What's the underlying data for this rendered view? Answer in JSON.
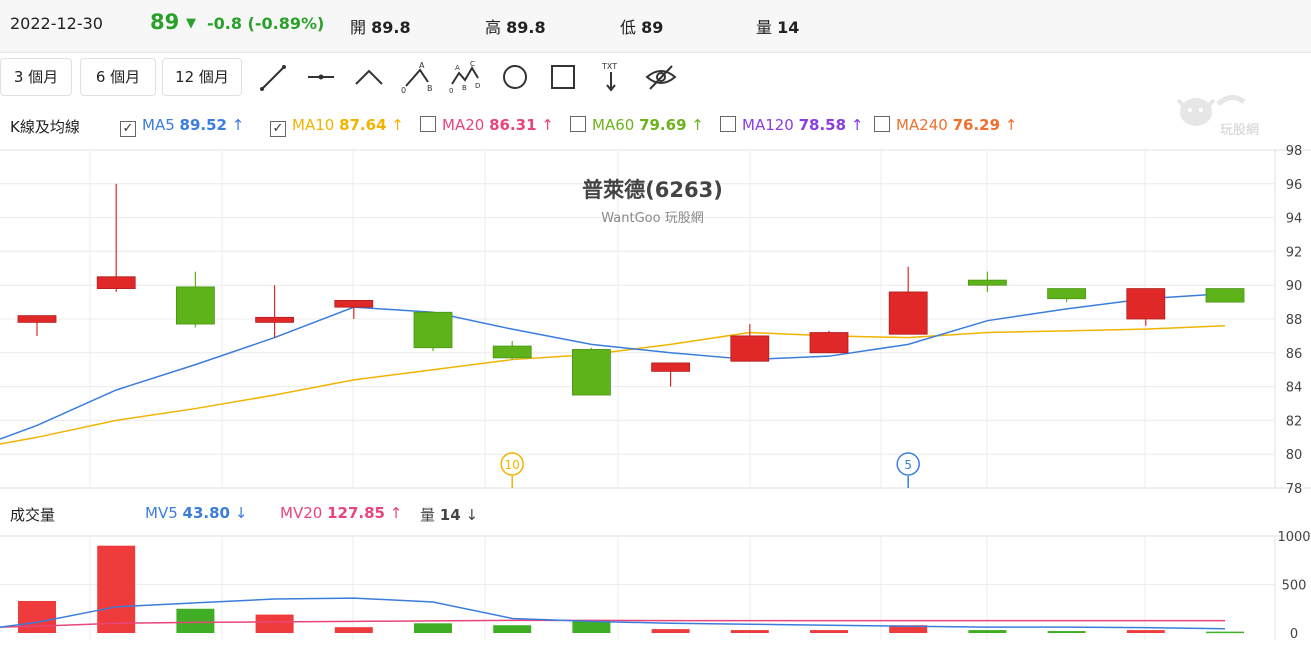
{
  "quote": {
    "date": "2022-12-30",
    "price": "89",
    "change": "-0.8 (-0.89%)",
    "open_label": "開",
    "open": "89.8",
    "high_label": "高",
    "high": "89.8",
    "low_label": "低",
    "low": "89",
    "volume_label": "量",
    "volume": "14"
  },
  "ranges": [
    "3 個月",
    "6 個月",
    "12 個月"
  ],
  "tools": [
    "line-tool-icon",
    "horizontal-line-tool-icon",
    "angle-tool-icon",
    "abc-pattern-tool-icon",
    "abcd-pattern-tool-icon",
    "circle-tool-icon",
    "rectangle-tool-icon",
    "text-tool-icon",
    "hide-drawings-icon"
  ],
  "kline_legend": {
    "label": "K線及均線",
    "items": [
      {
        "name": "MA5",
        "value": "89.52",
        "arrow": "↑",
        "checked": true,
        "color": "#3b7ddd"
      },
      {
        "name": "MA10",
        "value": "87.64",
        "arrow": "↑",
        "checked": true,
        "color": "#f0b400"
      },
      {
        "name": "MA20",
        "value": "86.31",
        "arrow": "↑",
        "checked": false,
        "color": "#e8457a"
      },
      {
        "name": "MA60",
        "value": "79.69",
        "arrow": "↑",
        "checked": false,
        "color": "#6bb31a"
      },
      {
        "name": "MA120",
        "value": "78.58",
        "arrow": "↑",
        "checked": false,
        "color": "#8a3ee0"
      },
      {
        "name": "MA240",
        "value": "76.29",
        "arrow": "↑",
        "checked": false,
        "color": "#f07030"
      }
    ]
  },
  "volume_legend": {
    "label": "成交量",
    "mv5_name": "MV5",
    "mv5_value": "43.80",
    "mv5_arrow": "↓",
    "mv20_name": "MV20",
    "mv20_value": "127.85",
    "mv20_arrow": "↑",
    "vol_name": "量",
    "vol_value": "14",
    "vol_arrow": "↓"
  },
  "logo_text": "玩股網",
  "chart_data": {
    "type": "candlestick",
    "title": "普萊德(6263)",
    "subtitle": "WantGoo 玩股網",
    "price_ylim": [
      78,
      98
    ],
    "price_ticks": [
      "98",
      "96",
      "94",
      "92",
      "90",
      "88",
      "86",
      "84",
      "82",
      "80",
      "78"
    ],
    "volume_ylim": [
      0,
      1000
    ],
    "volume_ticks": [
      "1000",
      "500",
      "0"
    ],
    "candles": [
      {
        "o": 88.2,
        "h": 88.2,
        "l": 87.0,
        "c": 87.8,
        "up": true
      },
      {
        "o": 89.8,
        "h": 96.0,
        "l": 89.6,
        "c": 90.5,
        "up": true
      },
      {
        "o": 89.9,
        "h": 90.8,
        "l": 87.5,
        "c": 87.7,
        "up": false
      },
      {
        "o": 87.8,
        "h": 90.0,
        "l": 86.9,
        "c": 88.1,
        "up": true
      },
      {
        "o": 88.7,
        "h": 89.1,
        "l": 88.0,
        "c": 89.1,
        "up": true
      },
      {
        "o": 88.4,
        "h": 88.4,
        "l": 86.1,
        "c": 86.3,
        "up": false
      },
      {
        "o": 86.4,
        "h": 86.7,
        "l": 85.6,
        "c": 85.7,
        "up": false
      },
      {
        "o": 86.2,
        "h": 86.3,
        "l": 83.5,
        "c": 83.5,
        "up": false
      },
      {
        "o": 84.9,
        "h": 85.4,
        "l": 84.0,
        "c": 85.4,
        "up": true
      },
      {
        "o": 85.5,
        "h": 87.7,
        "l": 85.5,
        "c": 87.0,
        "up": true
      },
      {
        "o": 86.0,
        "h": 87.3,
        "l": 86.0,
        "c": 87.2,
        "up": true
      },
      {
        "o": 87.1,
        "h": 91.1,
        "l": 87.1,
        "c": 89.6,
        "up": true
      },
      {
        "o": 90.3,
        "h": 90.8,
        "l": 89.6,
        "c": 90.0,
        "up": false
      },
      {
        "o": 89.8,
        "h": 89.8,
        "l": 89.0,
        "c": 89.2,
        "up": false
      },
      {
        "o": 88.0,
        "h": 89.8,
        "l": 87.6,
        "c": 89.8,
        "up": true
      },
      {
        "o": 89.8,
        "h": 89.8,
        "l": 89.0,
        "c": 89.0,
        "up": false
      }
    ],
    "ma5": [
      81.7,
      83.8,
      85.3,
      86.9,
      88.7,
      88.4,
      87.4,
      86.5,
      86.0,
      85.6,
      85.8,
      86.5,
      87.9,
      88.6,
      89.2,
      89.5
    ],
    "ma10": [
      81.0,
      82.0,
      82.7,
      83.5,
      84.4,
      85.0,
      85.6,
      85.9,
      86.5,
      87.2,
      87.0,
      86.9,
      87.2,
      87.3,
      87.4,
      87.6
    ],
    "ma5_start": 80.9,
    "ma10_start": 80.6,
    "volumes": [
      330,
      900,
      250,
      190,
      60,
      100,
      80,
      130,
      40,
      30,
      30,
      80,
      30,
      20,
      30,
      14
    ],
    "mv5": [
      110,
      270,
      310,
      350,
      360,
      320,
      150,
      120,
      100,
      90,
      80,
      70,
      60,
      60,
      55,
      44
    ],
    "mv20": [
      70,
      100,
      110,
      115,
      120,
      125,
      130,
      130,
      128,
      128,
      128,
      128,
      128,
      128,
      128,
      128
    ],
    "mv5_start": 60,
    "mv20_start": 60,
    "markers": [
      {
        "label": "10",
        "index": 6,
        "color": "#f0b400"
      },
      {
        "label": "5",
        "index": 11,
        "color": "#3b7ddd"
      }
    ],
    "colors": {
      "up": "#e02828",
      "down": "#5fb31a",
      "grid": "#ececec"
    }
  }
}
